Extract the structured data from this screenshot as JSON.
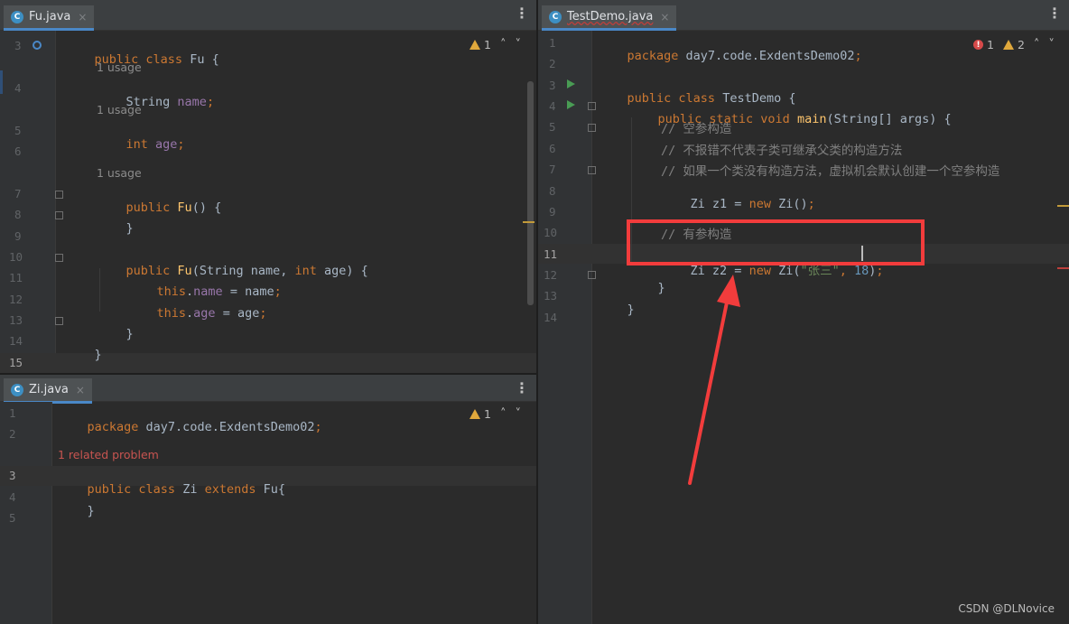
{
  "fu_pane": {
    "tab_label": "Fu.java",
    "tab_icon_letter": "C",
    "close_glyph": "×",
    "menu_glyph": "⋮",
    "warnings": "1",
    "line_numbers": [
      "3",
      "4",
      "5",
      "6",
      "7",
      "8",
      "9",
      "10",
      "11",
      "12",
      "13",
      "14",
      "15"
    ],
    "hints": {
      "usage_1": "1 usage",
      "usage_2": "1 usage",
      "usage_3": "1 usage"
    },
    "code": {
      "l3_kw": "public class ",
      "l3_name": "Fu ",
      "l3_brace": "{",
      "l4_type": "String ",
      "l4_field": "name",
      "l4_semi": ";",
      "l5_kw": "int ",
      "l5_field": "age",
      "l5_semi": ";",
      "l7_kw": "public ",
      "l7_fn": "Fu",
      "l7_rest": "() {",
      "l8": "}",
      "l10_kw": "public ",
      "l10_fn": "Fu",
      "l10_p1": "(String name, ",
      "l10_kw2": "int ",
      "l10_p2": "age) {",
      "l11_kw": "this",
      "l11_dot": ".",
      "l11_field": "name",
      "l11_rest": " = name",
      "l11_semi": ";",
      "l12_kw": "this",
      "l12_dot": ".",
      "l12_field": "age",
      "l12_rest": " = age",
      "l12_semi": ";",
      "l13": "}",
      "l14": "}"
    }
  },
  "zi_pane": {
    "tab_label": "Zi.java",
    "tab_icon_letter": "C",
    "close_glyph": "×",
    "menu_glyph": "⋮",
    "warnings": "1",
    "line_numbers": [
      "1",
      "2",
      "3",
      "4",
      "5"
    ],
    "problem_hint": "1 related problem",
    "code": {
      "l1_kw": "package ",
      "l1_pkg": "day7.code.ExdentsDemo02",
      "l1_semi": ";",
      "l3_kw": "public class ",
      "l3_name": "Zi ",
      "l3_kw2": "extends ",
      "l3_rest": "Fu{",
      "l4": "}"
    }
  },
  "test_pane": {
    "tab_label": "TestDemo.java",
    "tab_icon_letter": "C",
    "close_glyph": "×",
    "menu_glyph": "⋮",
    "errors": "1",
    "warnings": "2",
    "line_numbers": [
      "1",
      "2",
      "3",
      "4",
      "5",
      "6",
      "7",
      "8",
      "9",
      "10",
      "11",
      "12",
      "13",
      "14"
    ],
    "code": {
      "l1_kw": "package ",
      "l1_pkg": "day7.code.ExdentsDemo02",
      "l1_semi": ";",
      "l3_kw": "public class ",
      "l3_name": "TestDemo ",
      "l3_brace": "{",
      "l4_kw": "public static void ",
      "l4_fn": "main",
      "l4_rest": "(String[] args) {",
      "l5": "// 空参构造",
      "l6": "// 不报错不代表子类可继承父类的构造方法",
      "l7": "// 如果一个类没有构造方法，虚拟机会默认创建一个空参构造",
      "l8_type": "Zi ",
      "l8_var": "z1",
      "l8_eq": " = ",
      "l8_kw": "new ",
      "l8_rest": "Zi()",
      "l8_semi": ";",
      "l10": "// 有参构造",
      "l11_type": "Zi ",
      "l11_var": "z2",
      "l11_eq": " = ",
      "l11_kw": "new ",
      "l11_call": "Zi(",
      "l11_str": "\"张三\"",
      "l11_comma": ", ",
      "l11_num": "18",
      "l11_close": ")",
      "l11_semi": ";",
      "l12": "}",
      "l13": "}"
    }
  },
  "watermark": "CSDN @DLNovice",
  "colors": {
    "keyword": "#cc7832",
    "field": "#9876aa",
    "function": "#ffc66d",
    "string": "#6a8759",
    "number": "#6897bb",
    "comment": "#808080",
    "annotation_box": "#f23c3c"
  }
}
